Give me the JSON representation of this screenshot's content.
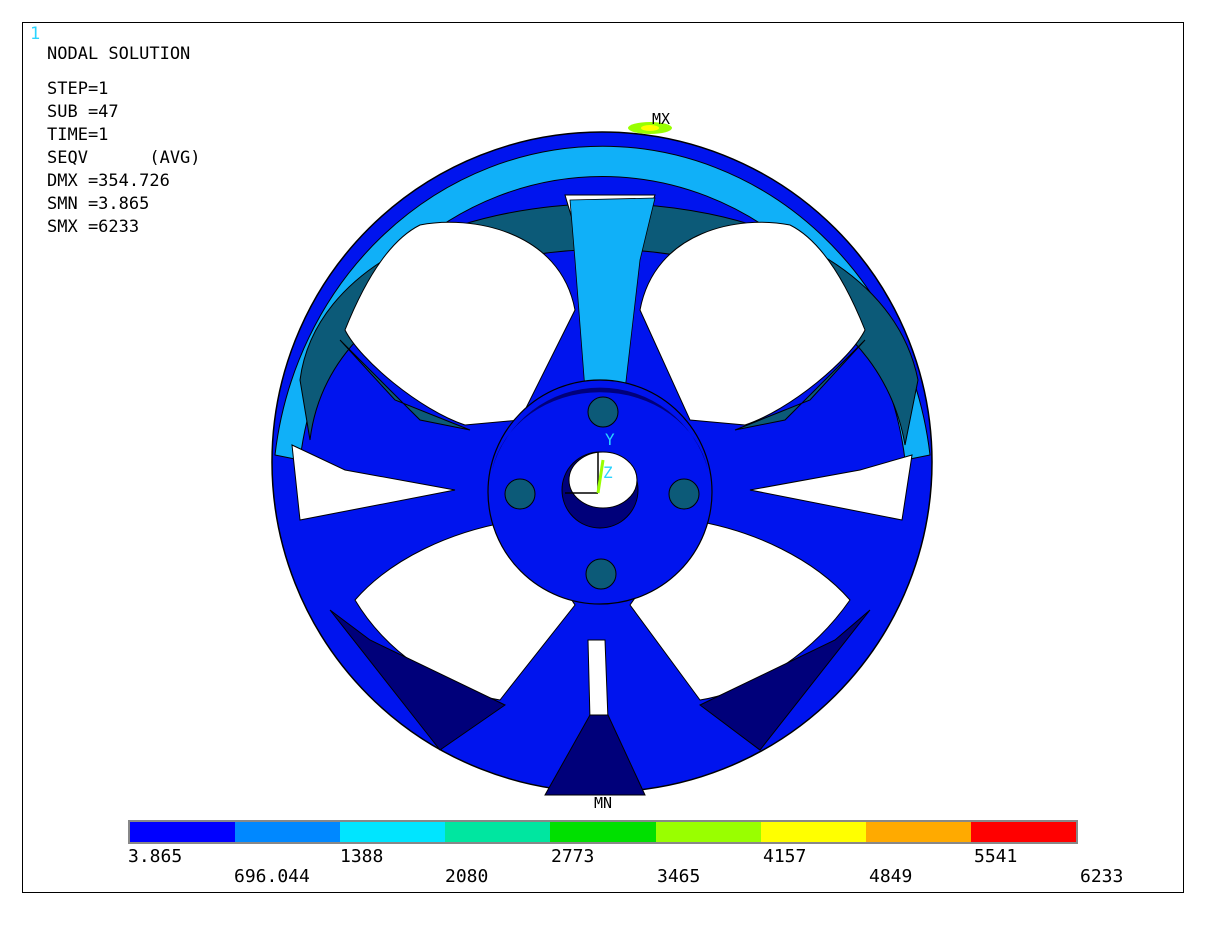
{
  "window_number": "1",
  "info": {
    "title": "NODAL SOLUTION",
    "step": "STEP=1",
    "sub": "SUB =47",
    "time": "TIME=1",
    "seqv": "SEQV      (AVG)",
    "dmx": "DMX =354.726",
    "smn": "SMN =3.865",
    "smx": "SMX =6233"
  },
  "markers": {
    "max": "MX",
    "min": "MN",
    "axis_y": "Y",
    "axis_z": "Z"
  },
  "legend": {
    "colors": [
      "#0000ff",
      "#0088ff",
      "#00e5ff",
      "#00e6a0",
      "#00e000",
      "#99ff00",
      "#ffff00",
      "#ffaa00",
      "#ff0000"
    ],
    "labels_top": [
      "3.865",
      "1388",
      "2773",
      "4157",
      "5541"
    ],
    "labels_bottom": [
      "696.044",
      "2080",
      "3465",
      "4849",
      "6233"
    ]
  },
  "palette": {
    "wheel_dark": "#00007a",
    "wheel_blue": "#0014ee",
    "wheel_light": "#10b0f8",
    "rim_teal": "#0c5a78"
  }
}
